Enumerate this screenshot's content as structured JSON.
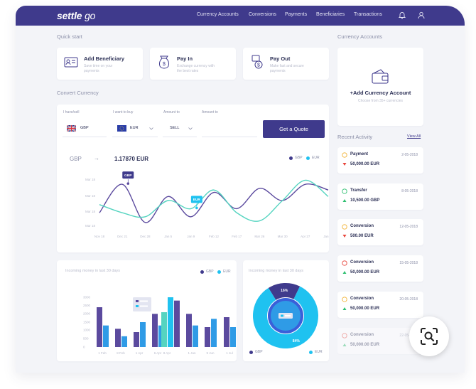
{
  "app": {
    "logo_bold": "settle",
    "logo_light": "go"
  },
  "nav": {
    "items": [
      "Currency Accounts",
      "Conversions",
      "Payments",
      "Beneficiaries",
      "Transactions"
    ]
  },
  "quick_start": {
    "title": "Quick start",
    "cards": [
      {
        "title": "Add Beneficiary",
        "sub1": "Save time on your",
        "sub2": "payments",
        "icon": "address-card-icon"
      },
      {
        "title": "Pay In",
        "sub1": "Exchange currency with",
        "sub2": "the best rates",
        "icon": "money-bag-icon"
      },
      {
        "title": "Pay Out",
        "sub1": "Make fast and secure",
        "sub2": "payments",
        "icon": "payout-icon"
      }
    ]
  },
  "currency_accounts": {
    "title": "Currency Accounts",
    "add_label": "+Add Currency Account",
    "sub": "Choose from 35+ currencies"
  },
  "convert": {
    "title": "Convert Currency",
    "field_labels": [
      "I have/sell",
      "I want to buy",
      "Amount to",
      "Amount to"
    ],
    "have_currency": "GBP",
    "buy_currency": "EUR",
    "amount_mode": "SELL",
    "quote_button": "Get a Quote",
    "pair_from": "GBP",
    "arrow": "→",
    "rate": "1.17870 EUR",
    "legend": [
      "GBP",
      "EUR"
    ]
  },
  "recent_activity": {
    "title": "Recent Activity",
    "view_all": "View All",
    "items": [
      {
        "type": "Payment",
        "date": "2-05-2018",
        "amount": "50,000.00 EUR",
        "direction": "down",
        "status_color": "#f2b233"
      },
      {
        "type": "Transfer",
        "date": "8-05-2018",
        "amount": "10,500.00 GBP",
        "direction": "up",
        "status_color": "#2fbf71"
      },
      {
        "type": "Conversion",
        "date": "12-05-2018",
        "amount": "500.00 EUR",
        "direction": "down",
        "status_color": "#f2b233"
      },
      {
        "type": "Conversion",
        "date": "15-05-2018",
        "amount": "50,000.00 EUR",
        "direction": "up",
        "status_color": "#e8443a"
      },
      {
        "type": "Conversion",
        "date": "20-05-2018",
        "amount": "50,000.00 EUR",
        "direction": "up",
        "status_color": "#f2b233"
      },
      {
        "type": "Conversion",
        "date": "22-05-2018",
        "amount": "50,000.00 EUR",
        "direction": "up",
        "status_color": "#e8443a"
      }
    ]
  },
  "bar_panel": {
    "title": "Incoming money in last 30 days",
    "legend": [
      "GBP",
      "EUR"
    ]
  },
  "donut_panel": {
    "title": "Incoming money in last 30 days",
    "legend": [
      "GBP",
      "EUR"
    ]
  },
  "colors": {
    "brand": "#3f3a8c",
    "purple": "#5b4a9e",
    "teal": "#55d4c0",
    "blue": "#2f9be6",
    "cyan": "#1fc2f0"
  },
  "chart_data": [
    {
      "type": "line",
      "x": [
        "Nov 18",
        "Dec 21",
        "Dec 28",
        "Jan 5",
        "Jan 9",
        "Feb 12",
        "Feb 17",
        "Mar 26",
        "Mar 30",
        "Apr 27",
        "Jan 28"
      ],
      "series": [
        {
          "name": "GBP",
          "values": [
            1.12,
            1.155,
            1.108,
            1.14,
            1.115,
            1.145,
            1.125,
            1.15,
            1.135,
            1.155,
            1.148
          ]
        },
        {
          "name": "EUR",
          "values": [
            1.13,
            1.12,
            1.115,
            1.135,
            1.125,
            1.148,
            1.12,
            1.11,
            1.135,
            1.16,
            1.14
          ]
        }
      ],
      "y_ticks": [
        "Mar 18",
        "Mar 18",
        "Mar 18",
        "Mar 18"
      ],
      "markers": [
        "GBP",
        "EUR"
      ]
    },
    {
      "type": "bar",
      "categories": [
        "1 Feb",
        "8 Feb",
        "1 Apr",
        "6 Apr",
        "8 Apr",
        "1 Jun",
        "9 Jun",
        "1 Jul",
        "9 Jul"
      ],
      "y_ticks": [
        "3000",
        "2500",
        "2000",
        "1500",
        "1000",
        "500",
        "0"
      ],
      "series": [
        {
          "name": "purple",
          "values": [
            2400,
            1100,
            900,
            2000,
            2800,
            2000,
            1200,
            1800,
            1300
          ]
        },
        {
          "name": "blue",
          "values": [
            1300,
            650,
            1500,
            1300,
            0,
            1300,
            1700,
            1200,
            0
          ]
        },
        {
          "name": "teal",
          "values": [
            0,
            0,
            0,
            0,
            2100,
            0,
            0,
            0,
            0
          ]
        },
        {
          "name": "cyan",
          "values": [
            0,
            0,
            0,
            0,
            3000,
            0,
            0,
            0,
            0
          ]
        }
      ],
      "tooltip": [
        "",
        ""
      ]
    },
    {
      "type": "pie",
      "categories": [
        "GBP",
        "EUR"
      ],
      "values": [
        16,
        84
      ],
      "labels": [
        "16%",
        "84%"
      ]
    }
  ]
}
